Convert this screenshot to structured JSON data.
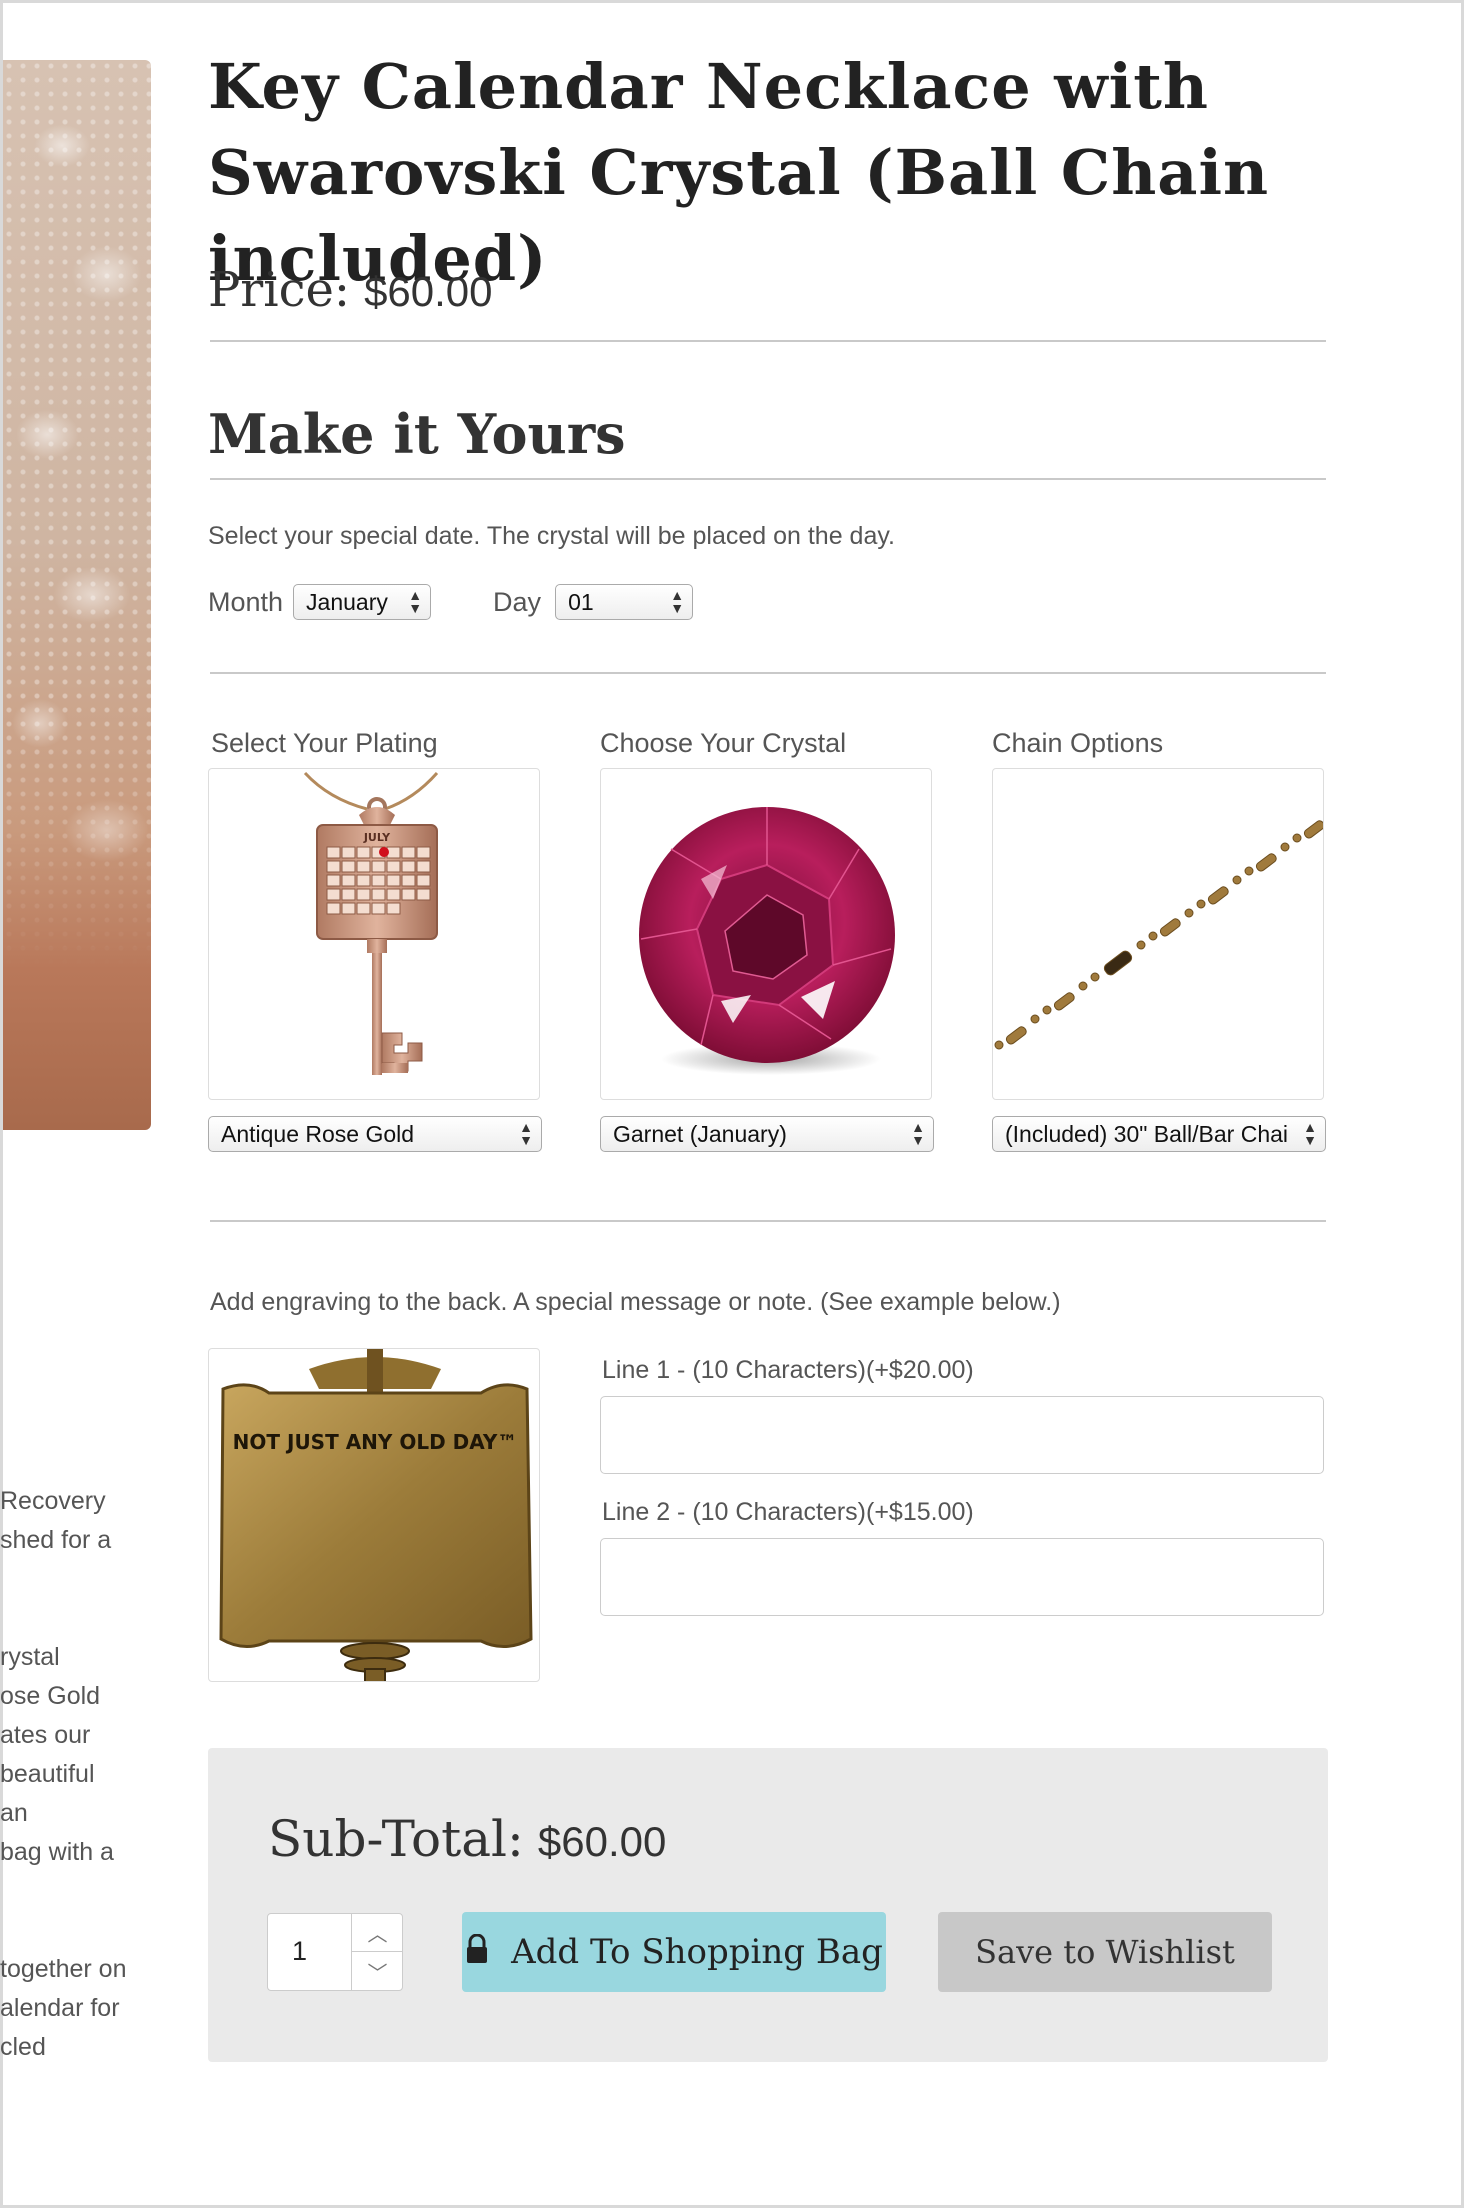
{
  "product": {
    "title": "Key Calendar Necklace with Swarovski Crystal (Ball Chain included)",
    "price_label": "Price:",
    "price": "$60.00"
  },
  "customize": {
    "section_title": "Make it Yours",
    "date_instruction": "Select your special date. The crystal will be placed on the day.",
    "month_label": "Month",
    "month_value": "January",
    "day_label": "Day",
    "day_value": "01"
  },
  "options": {
    "plating": {
      "label": "Select Your Plating",
      "value": "Antique Rose Gold",
      "image_month": "JULY"
    },
    "crystal": {
      "label": "Choose Your Crystal",
      "value": "Garnet (January)"
    },
    "chain": {
      "label": "Chain Options",
      "value": "(Included) 30\" Ball/Bar Chai"
    }
  },
  "engraving": {
    "instruction": "Add engraving to the back. A special message or note. (See example below.)",
    "example_text": "NOT JUST ANY OLD DAY™",
    "line1_label": "Line 1 - (10 Characters)(+$20.00)",
    "line1_value": "",
    "line2_label": "Line 2 - (10 Characters)(+$15.00)",
    "line2_value": ""
  },
  "checkout": {
    "subtotal_label": "Sub-Total:",
    "subtotal_value": "$60.00",
    "quantity": "1",
    "add_to_bag": "Add To Shopping Bag",
    "save_wishlist": "Save to Wishlist"
  },
  "side_description": [
    "Recovery",
    "shed for a",
    "",
    "",
    "rystal",
    "ose Gold",
    "ates our",
    "beautiful",
    "an",
    "bag with a",
    "",
    "",
    "together on",
    "alendar for",
    "cled"
  ],
  "icons": {
    "lock": "lock-icon",
    "up": "chevron-up-icon",
    "down": "chevron-down-icon"
  },
  "colors": {
    "accent_button": "#99d7df",
    "wishlist_button": "#c8c8c8",
    "panel": "#eaeaea"
  }
}
